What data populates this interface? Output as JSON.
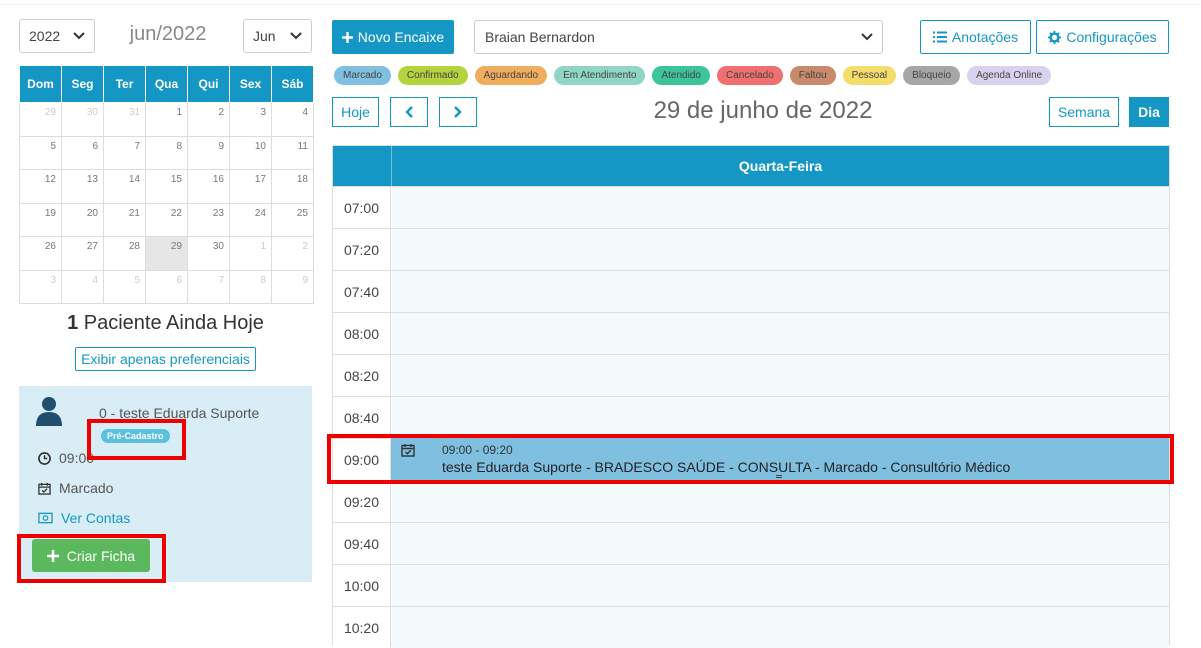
{
  "left": {
    "year_select": "2022",
    "month_title": "jun/2022",
    "month_select": "Jun",
    "weekdays": [
      "Dom",
      "Seg",
      "Ter",
      "Qua",
      "Qui",
      "Sex",
      "Sáb"
    ],
    "weeks": [
      [
        "29",
        "30",
        "31",
        "1",
        "2",
        "3",
        "4"
      ],
      [
        "5",
        "6",
        "7",
        "8",
        "9",
        "10",
        "11"
      ],
      [
        "12",
        "13",
        "14",
        "15",
        "16",
        "17",
        "18"
      ],
      [
        "19",
        "20",
        "21",
        "22",
        "23",
        "24",
        "25"
      ],
      [
        "26",
        "27",
        "28",
        "29",
        "30",
        "1",
        "2"
      ],
      [
        "3",
        "4",
        "5",
        "6",
        "7",
        "8",
        "9"
      ]
    ],
    "patients_count": "1",
    "patients_text": " Paciente Ainda Hoje",
    "preferred_button": "Exibir apenas preferenciais",
    "card": {
      "patient_name": "0 - teste Eduarda Suporte",
      "badge": "Pré-Cadastro",
      "time": "09:00",
      "status": "Marcado",
      "accounts_link": "Ver Contas",
      "create_button": "Criar Ficha"
    }
  },
  "toolbar": {
    "new_fit_button": "Novo Encaixe",
    "professional_select": "Braian Bernardon",
    "notes_button": "Anotações",
    "settings_button": "Configurações"
  },
  "legend": [
    {
      "label": "Marcado",
      "color": "#7fbfe0"
    },
    {
      "label": "Confirmado",
      "color": "#b5d33d"
    },
    {
      "label": "Aguardando",
      "color": "#f0ad5e"
    },
    {
      "label": "Em Atendimento",
      "color": "#8fd6c4"
    },
    {
      "label": "Atendido",
      "color": "#3cc59a"
    },
    {
      "label": "Cancelado",
      "color": "#f07070"
    },
    {
      "label": "Faltou",
      "color": "#c88a6a"
    },
    {
      "label": "Pessoal",
      "color": "#f5dc6b"
    },
    {
      "label": "Bloqueio",
      "color": "#a6a6a6"
    },
    {
      "label": "Agenda Online",
      "color": "#d9d2ee"
    }
  ],
  "nav": {
    "today_button": "Hoje",
    "date_title": "29 de junho de 2022",
    "week_button": "Semana",
    "day_button": "Dia"
  },
  "schedule": {
    "day_name": "Quarta-Feira",
    "slots": [
      "07:00",
      "07:20",
      "07:40",
      "08:00",
      "08:20",
      "08:40",
      "09:00",
      "09:20",
      "09:40",
      "10:00",
      "10:20"
    ],
    "event": {
      "time": "09:00 - 09:20",
      "text": "teste Eduarda Suporte - BRADESCO SAÚDE - CONSULTA - Marcado - Consultório Médico"
    }
  }
}
